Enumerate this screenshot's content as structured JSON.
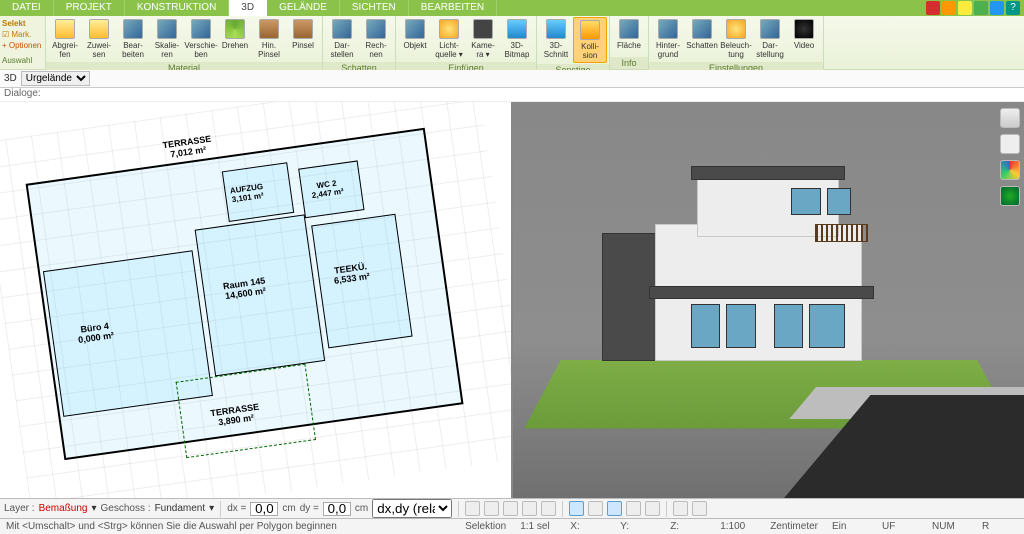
{
  "menu": {
    "tabs": [
      "DATEI",
      "PROJEKT",
      "KONSTRUKTION",
      "3D",
      "GELÄNDE",
      "SICHTEN",
      "BEARBEITEN"
    ],
    "active_tab": "3D"
  },
  "selekt": {
    "title": "Selekt",
    "mark": "☑ Mark.",
    "opt": "+ Optionen",
    "group": "Auswahl"
  },
  "ribbon_groups": [
    {
      "label": "Material",
      "buttons": [
        {
          "l1": "Abgrei-",
          "l2": "fen",
          "ico": "i-sel"
        },
        {
          "l1": "Zuwei-",
          "l2": "sen",
          "ico": "i-sel"
        },
        {
          "l1": "Bear-",
          "l2": "beiten",
          "ico": "i-cube"
        },
        {
          "l1": "Skalie-",
          "l2": "ren",
          "ico": "i-cube"
        },
        {
          "l1": "Verschie-",
          "l2": "ben",
          "ico": "i-cube"
        },
        {
          "l1": "Drehen",
          "l2": "",
          "ico": "i-rot"
        },
        {
          "l1": "Hin.",
          "l2": "Pinsel",
          "ico": "i-brush"
        },
        {
          "l1": "Pinsel",
          "l2": "",
          "ico": "i-brush"
        }
      ]
    },
    {
      "label": "Schatten",
      "buttons": [
        {
          "l1": "Dar-",
          "l2": "stellen",
          "ico": "i-cube"
        },
        {
          "l1": "Rech-",
          "l2": "nen",
          "ico": "i-cube"
        }
      ]
    },
    {
      "label": "Einfügen",
      "buttons": [
        {
          "l1": "Objekt",
          "l2": "",
          "ico": "i-cube"
        },
        {
          "l1": "Licht-",
          "l2": "quelle ▾",
          "ico": "i-light"
        },
        {
          "l1": "Kame-",
          "l2": "ra ▾",
          "ico": "i-cam"
        },
        {
          "l1": "3D-",
          "l2": "Bitmap",
          "ico": "i-3d"
        }
      ]
    },
    {
      "label": "Sonstige",
      "buttons": [
        {
          "l1": "3D-",
          "l2": "Schnitt",
          "ico": "i-3d"
        },
        {
          "l1": "Kolli-",
          "l2": "sion",
          "ico": "i-cut",
          "hl": true
        }
      ]
    },
    {
      "label": "Info",
      "buttons": [
        {
          "l1": "Fläche",
          "l2": "",
          "ico": "i-cube"
        }
      ]
    },
    {
      "label": "Einstellungen",
      "buttons": [
        {
          "l1": "Hinter-",
          "l2": "grund",
          "ico": "i-cube"
        },
        {
          "l1": "Schatten",
          "l2": "",
          "ico": "i-cube"
        },
        {
          "l1": "Beleuch-",
          "l2": "tung",
          "ico": "i-light"
        },
        {
          "l1": "Dar-",
          "l2": "stellung",
          "ico": "i-cube"
        },
        {
          "l1": "Video",
          "l2": "",
          "ico": "i-vid"
        }
      ]
    }
  ],
  "context": {
    "mode": "3D",
    "layer_opt": "Urgelände"
  },
  "dialog_label": "Dialoge:",
  "plan": {
    "terrasse1": {
      "name": "TERRASSE",
      "area": "7,012 m²"
    },
    "terrasse2": {
      "name": "TERRASSE",
      "area": "3,890 m²"
    },
    "buero": {
      "name": "Büro 4",
      "area": "0,000 m²"
    },
    "raum": {
      "name": "Raum 145",
      "area": "14,600 m²"
    },
    "teeku": {
      "name": "TEEKÜ.",
      "area": "6,533 m²"
    },
    "aufzug": {
      "name": "AUFZUG",
      "area": "3,101 m²"
    },
    "wc": {
      "name": "WC 2",
      "area": "2,447 m²"
    }
  },
  "bottom": {
    "layer_lbl": "Layer :",
    "layer_val": "Bemaßung",
    "geschoss_lbl": "Geschoss :",
    "geschoss_val": "Fundament",
    "dx_lbl": "dx =",
    "dx_val": "0,0",
    "dy_lbl": "dy =",
    "dy_val": "0,0",
    "unit": "cm",
    "mode": "dx,dy (relativ ka"
  },
  "status": {
    "hint": "Mit <Umschalt> und <Strg> können Sie die Auswahl per Polygon beginnen",
    "sel": "Selektion",
    "scale_sel": "1:1 sel",
    "x": "X:",
    "y": "Y:",
    "z": "Z:",
    "scale": "1:100",
    "unit": "Zentimeter",
    "ein": "Ein",
    "uf": "UF",
    "num": "NUM",
    "r": "R"
  }
}
